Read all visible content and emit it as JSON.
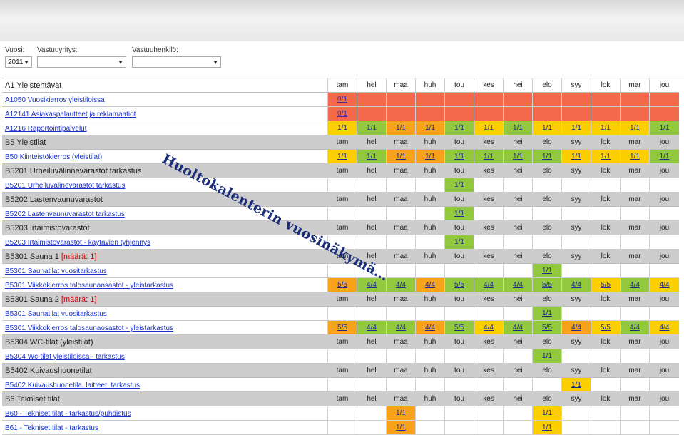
{
  "filters": {
    "year": {
      "label": "Vuosi:",
      "value": "2011"
    },
    "responsibility": {
      "label": "Vastuuyritys:",
      "value": ""
    },
    "person": {
      "label": "Vastuuhenkilö:",
      "value": ""
    }
  },
  "months": [
    "tam",
    "hel",
    "maa",
    "huh",
    "tou",
    "kes",
    "hei",
    "elo",
    "syy",
    "lok",
    "mar",
    "jou"
  ],
  "colors": {
    "red": "#f26a4b",
    "yellow": "#fcd000",
    "orange": "#f7a21b",
    "green": "#92c83e",
    "header": "#cdcdcd",
    "link": "#1a33c9"
  },
  "rows": [
    {
      "type": "group",
      "label": "A1 Yleistehtävät",
      "first": true
    },
    {
      "type": "task",
      "label": "A1050 Vuosikierros yleistiloissa",
      "cells": [
        [
          "0/1",
          "red"
        ],
        [
          "",
          "red"
        ],
        [
          "",
          "red"
        ],
        [
          "",
          "red"
        ],
        [
          "",
          "red"
        ],
        [
          "",
          "red"
        ],
        [
          "",
          "red"
        ],
        [
          "",
          "red"
        ],
        [
          "",
          "red"
        ],
        [
          "",
          "red"
        ],
        [
          "",
          "red"
        ],
        [
          "",
          "red"
        ]
      ]
    },
    {
      "type": "task",
      "label": "A12141 Asiakaspalautteet ja reklamaatiot",
      "cells": [
        [
          "0/1",
          "red"
        ],
        [
          "",
          "red"
        ],
        [
          "",
          "red"
        ],
        [
          "",
          "red"
        ],
        [
          "",
          "red"
        ],
        [
          "",
          "red"
        ],
        [
          "",
          "red"
        ],
        [
          "",
          "red"
        ],
        [
          "",
          "red"
        ],
        [
          "",
          "red"
        ],
        [
          "",
          "red"
        ],
        [
          "",
          "red"
        ]
      ]
    },
    {
      "type": "task",
      "label": "A1216 Raportointipalvelut",
      "cells": [
        [
          "1/1",
          "yellow"
        ],
        [
          "1/1",
          "green"
        ],
        [
          "1/1",
          "orange"
        ],
        [
          "1/1",
          "orange"
        ],
        [
          "1/1",
          "green"
        ],
        [
          "1/1",
          "yellow"
        ],
        [
          "1/1",
          "green"
        ],
        [
          "1/1",
          "yellow"
        ],
        [
          "1/1",
          "yellow"
        ],
        [
          "1/1",
          "yellow"
        ],
        [
          "1/1",
          "yellow"
        ],
        [
          "1/1",
          "green"
        ]
      ]
    },
    {
      "type": "group",
      "label": "B5 Yleistilat"
    },
    {
      "type": "task",
      "label": "B50 Kiinteistökierros (yleistilat)",
      "cells": [
        [
          "1/1",
          "yellow"
        ],
        [
          "1/1",
          "green"
        ],
        [
          "1/1",
          "orange"
        ],
        [
          "1/1",
          "orange"
        ],
        [
          "1/1",
          "green"
        ],
        [
          "1/1",
          "green"
        ],
        [
          "1/1",
          "green"
        ],
        [
          "1/1",
          "green"
        ],
        [
          "1/1",
          "yellow"
        ],
        [
          "1/1",
          "yellow"
        ],
        [
          "1/1",
          "yellow"
        ],
        [
          "1/1",
          "green"
        ]
      ]
    },
    {
      "type": "group",
      "label": "B5201 Urheiluvälinnevarastot tarkastus"
    },
    {
      "type": "task",
      "label": "B5201 Urheiluvälinevarastot tarkastus",
      "cells": [
        [
          "",
          ""
        ],
        [
          "",
          ""
        ],
        [
          "",
          ""
        ],
        [
          "",
          ""
        ],
        [
          "1/1",
          "green"
        ],
        [
          "",
          ""
        ],
        [
          "",
          ""
        ],
        [
          "",
          ""
        ],
        [
          "",
          ""
        ],
        [
          "",
          ""
        ],
        [
          "",
          ""
        ],
        [
          "",
          ""
        ]
      ]
    },
    {
      "type": "group",
      "label": "B5202 Lastenvaunuvarastot"
    },
    {
      "type": "task",
      "label": "B5202 Lastenvaunuvarastot tarkastus",
      "cells": [
        [
          "",
          ""
        ],
        [
          "",
          ""
        ],
        [
          "",
          ""
        ],
        [
          "",
          ""
        ],
        [
          "1/1",
          "green"
        ],
        [
          "",
          ""
        ],
        [
          "",
          ""
        ],
        [
          "",
          ""
        ],
        [
          "",
          ""
        ],
        [
          "",
          ""
        ],
        [
          "",
          ""
        ],
        [
          "",
          ""
        ]
      ]
    },
    {
      "type": "group",
      "label": "B5203 Irtaimistovarastot"
    },
    {
      "type": "task",
      "label": "B5203 Irtaimistovarastot - käytävien tyhjennys",
      "cells": [
        [
          "",
          ""
        ],
        [
          "",
          ""
        ],
        [
          "",
          ""
        ],
        [
          "",
          ""
        ],
        [
          "1/1",
          "green"
        ],
        [
          "",
          ""
        ],
        [
          "",
          ""
        ],
        [
          "",
          ""
        ],
        [
          "",
          ""
        ],
        [
          "",
          ""
        ],
        [
          "",
          ""
        ],
        [
          "",
          ""
        ]
      ]
    },
    {
      "type": "group",
      "label": "B5301 Sauna 1 ",
      "qty": "[määrä: 1]"
    },
    {
      "type": "task",
      "label": "B5301 Saunatilat vuositarkastus",
      "cells": [
        [
          "",
          ""
        ],
        [
          "",
          ""
        ],
        [
          "",
          ""
        ],
        [
          "",
          ""
        ],
        [
          "",
          ""
        ],
        [
          "",
          ""
        ],
        [
          "",
          ""
        ],
        [
          "1/1",
          "green"
        ],
        [
          "",
          ""
        ],
        [
          "",
          ""
        ],
        [
          "",
          ""
        ],
        [
          "",
          ""
        ]
      ]
    },
    {
      "type": "task",
      "label": "B5301 Viikkokierros talosaunaosastot - yleistarkastus",
      "cells": [
        [
          "5/5",
          "orange"
        ],
        [
          "4/4",
          "green"
        ],
        [
          "4/4",
          "green"
        ],
        [
          "4/4",
          "orange"
        ],
        [
          "5/5",
          "green"
        ],
        [
          "4/4",
          "green"
        ],
        [
          "4/4",
          "green"
        ],
        [
          "5/5",
          "green"
        ],
        [
          "4/4",
          "green"
        ],
        [
          "5/5",
          "yellow"
        ],
        [
          "4/4",
          "green"
        ],
        [
          "4/4",
          "yellow"
        ]
      ]
    },
    {
      "type": "group",
      "label": "B5301 Sauna 2 ",
      "qty": "[määrä: 1]"
    },
    {
      "type": "task",
      "label": "B5301 Saunatilat vuositarkastus",
      "cells": [
        [
          "",
          ""
        ],
        [
          "",
          ""
        ],
        [
          "",
          ""
        ],
        [
          "",
          ""
        ],
        [
          "",
          ""
        ],
        [
          "",
          ""
        ],
        [
          "",
          ""
        ],
        [
          "1/1",
          "green"
        ],
        [
          "",
          ""
        ],
        [
          "",
          ""
        ],
        [
          "",
          ""
        ],
        [
          "",
          ""
        ]
      ]
    },
    {
      "type": "task",
      "label": "B5301 Viikkokierros talosaunaosastot - yleistarkastus",
      "cells": [
        [
          "5/5",
          "orange"
        ],
        [
          "4/4",
          "green"
        ],
        [
          "4/4",
          "green"
        ],
        [
          "4/4",
          "orange"
        ],
        [
          "5/5",
          "green"
        ],
        [
          "4/4",
          "yellow"
        ],
        [
          "4/4",
          "green"
        ],
        [
          "5/5",
          "green"
        ],
        [
          "4/4",
          "orange"
        ],
        [
          "5/5",
          "yellow"
        ],
        [
          "4/4",
          "green"
        ],
        [
          "4/4",
          "yellow"
        ]
      ]
    },
    {
      "type": "group",
      "label": "B5304 WC-tilat (yleistilat)"
    },
    {
      "type": "task",
      "label": "B5304 Wc-tilat yleistiloissa - tarkastus",
      "cells": [
        [
          "",
          ""
        ],
        [
          "",
          ""
        ],
        [
          "",
          ""
        ],
        [
          "",
          ""
        ],
        [
          "",
          ""
        ],
        [
          "",
          ""
        ],
        [
          "",
          ""
        ],
        [
          "1/1",
          "green"
        ],
        [
          "",
          ""
        ],
        [
          "",
          ""
        ],
        [
          "",
          ""
        ],
        [
          "",
          ""
        ]
      ]
    },
    {
      "type": "group",
      "label": "B5402 Kuivaushuonetilat"
    },
    {
      "type": "task",
      "label": "B5402 Kuivaushuonetila, laitteet, tarkastus",
      "cells": [
        [
          "",
          ""
        ],
        [
          "",
          ""
        ],
        [
          "",
          ""
        ],
        [
          "",
          ""
        ],
        [
          "",
          ""
        ],
        [
          "",
          ""
        ],
        [
          "",
          ""
        ],
        [
          "",
          ""
        ],
        [
          "1/1",
          "yellow"
        ],
        [
          "",
          ""
        ],
        [
          "",
          ""
        ],
        [
          "",
          ""
        ]
      ]
    },
    {
      "type": "group",
      "label": "B6 Tekniset tilat"
    },
    {
      "type": "task",
      "label": "B60 - Tekniset tilat - tarkastus/puhdistus",
      "cells": [
        [
          "",
          ""
        ],
        [
          "",
          ""
        ],
        [
          "1/1",
          "orange"
        ],
        [
          "",
          ""
        ],
        [
          "",
          ""
        ],
        [
          "",
          ""
        ],
        [
          "",
          ""
        ],
        [
          "1/1",
          "yellow"
        ],
        [
          "",
          ""
        ],
        [
          "",
          ""
        ],
        [
          "",
          ""
        ],
        [
          "",
          ""
        ]
      ]
    },
    {
      "type": "task",
      "label": "B61 - Tekniset tilat - tarkastus",
      "cells": [
        [
          "",
          ""
        ],
        [
          "",
          ""
        ],
        [
          "1/1",
          "orange"
        ],
        [
          "",
          ""
        ],
        [
          "",
          ""
        ],
        [
          "",
          ""
        ],
        [
          "",
          ""
        ],
        [
          "1/1",
          "yellow"
        ],
        [
          "",
          ""
        ],
        [
          "",
          ""
        ],
        [
          "",
          ""
        ],
        [
          "",
          ""
        ]
      ]
    }
  ],
  "watermark": "Huoltokalenterin vuosinäkymä…"
}
